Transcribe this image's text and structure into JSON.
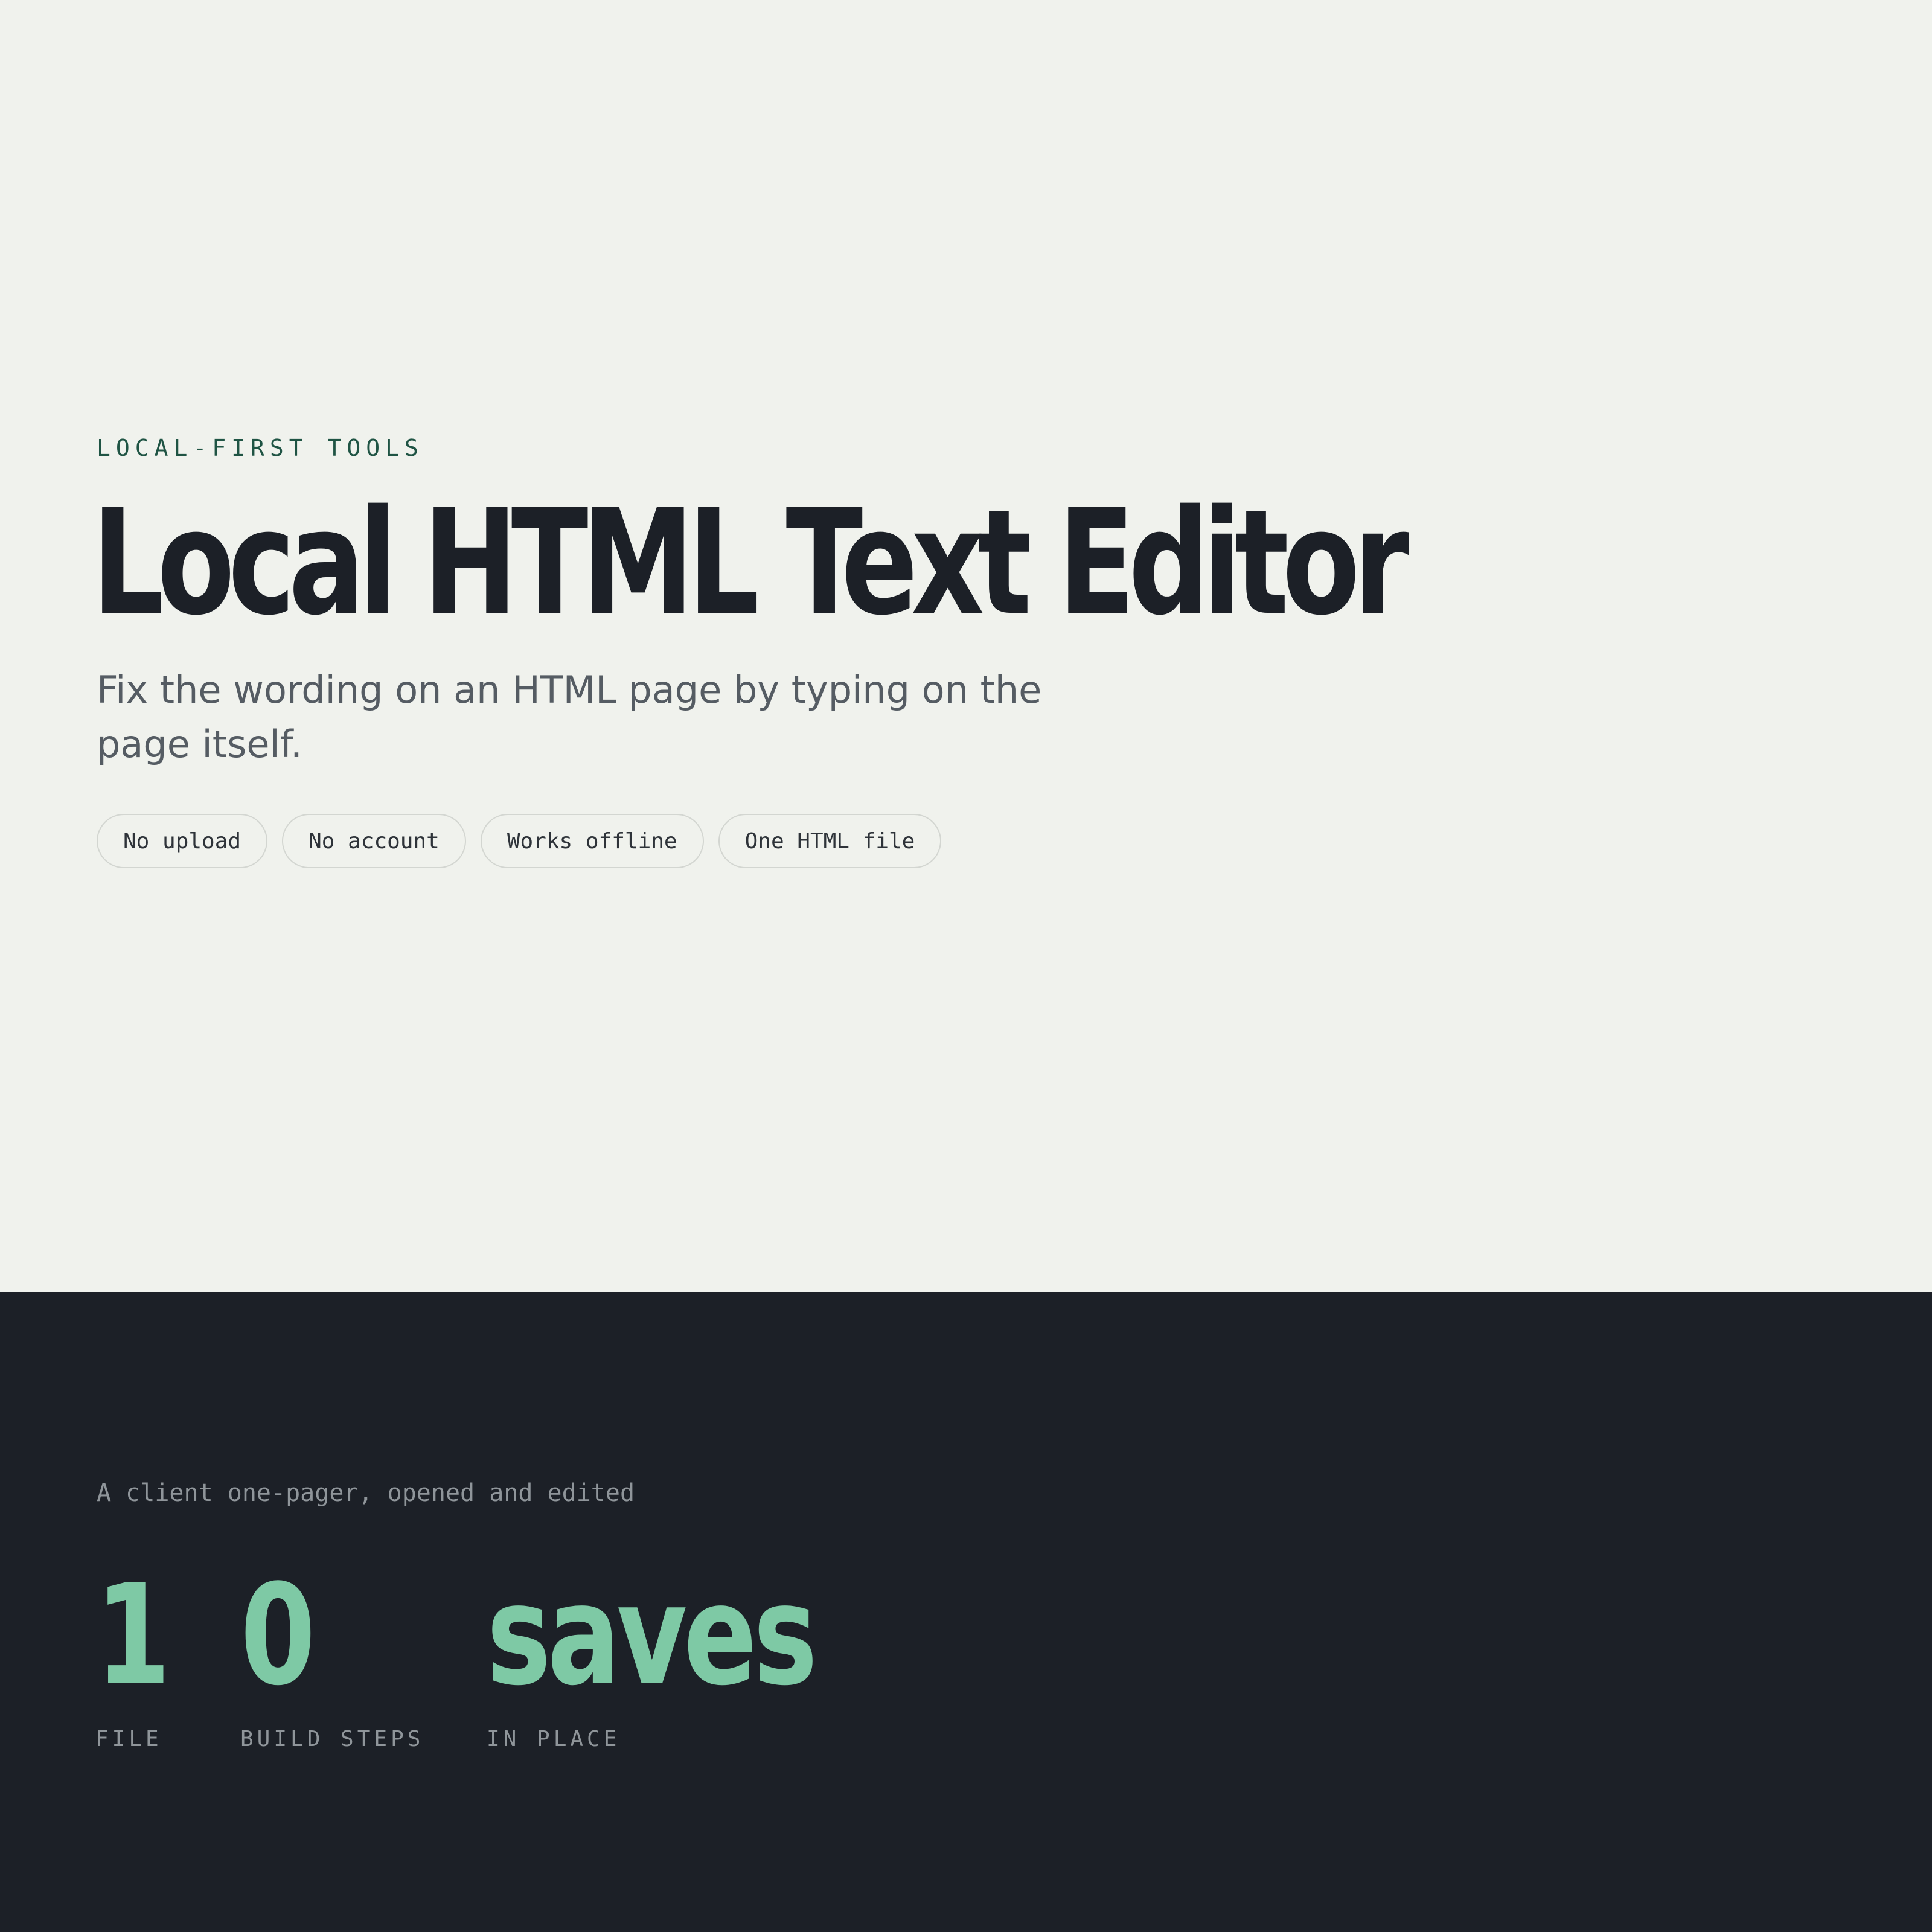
{
  "hero": {
    "eyebrow": "LOCAL-FIRST TOOLS",
    "title": "Local HTML Text Editor",
    "subtitle": "Fix the wording on an HTML page by typing on the page itself.",
    "tags": [
      "No upload",
      "No account",
      "Works offline",
      "One HTML file"
    ]
  },
  "demo": {
    "caption": "A client one-pager, opened and edited",
    "stats": [
      {
        "value": "1",
        "label": "FILE"
      },
      {
        "value": "0",
        "label": "BUILD STEPS"
      },
      {
        "value": "saves",
        "label": "IN PLACE"
      }
    ]
  },
  "colors": {
    "hero_background": "#f0f2ed",
    "dark_background": "#1c2027",
    "accent_green": "#7ec9a5",
    "eyebrow_green": "#1f5444",
    "title_text": "#1c2027",
    "muted_text": "#8f959a"
  }
}
